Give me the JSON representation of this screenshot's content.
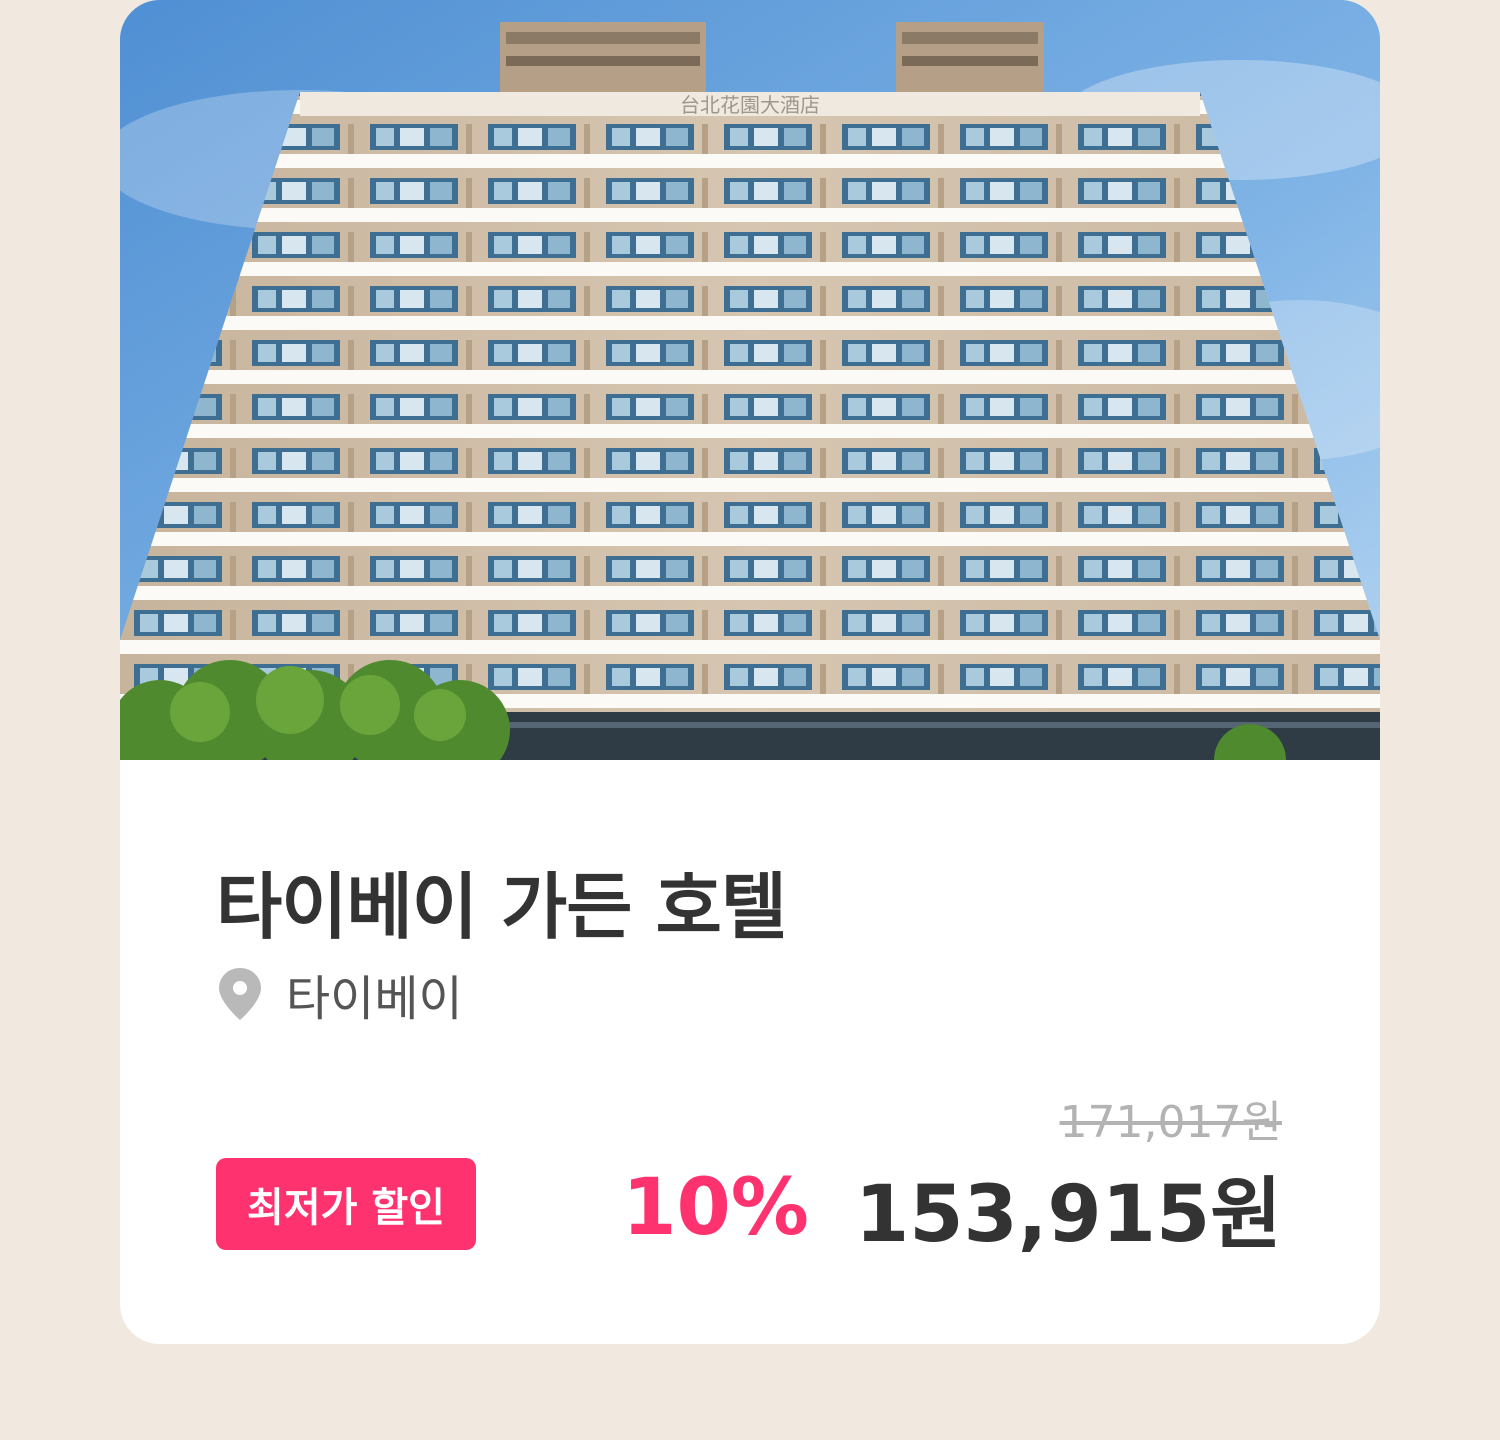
{
  "hotel": {
    "name": "타이베이 가든 호텔",
    "location": "타이베이",
    "original_price": "171,017원",
    "discount_percent": "10%",
    "sale_price": "153,915원",
    "badge_label": "최저가 할인",
    "building_sign": "台北花園大酒店"
  },
  "icons": {
    "location": "map-pin-icon"
  },
  "colors": {
    "page_background": "#f1e8e0",
    "card_background": "#ffffff",
    "accent": "#ff3270",
    "title_text": "#333333",
    "secondary_text": "#555555",
    "strikethrough_text": "#b3b3b3",
    "icon_gray": "#b9b9b9"
  }
}
